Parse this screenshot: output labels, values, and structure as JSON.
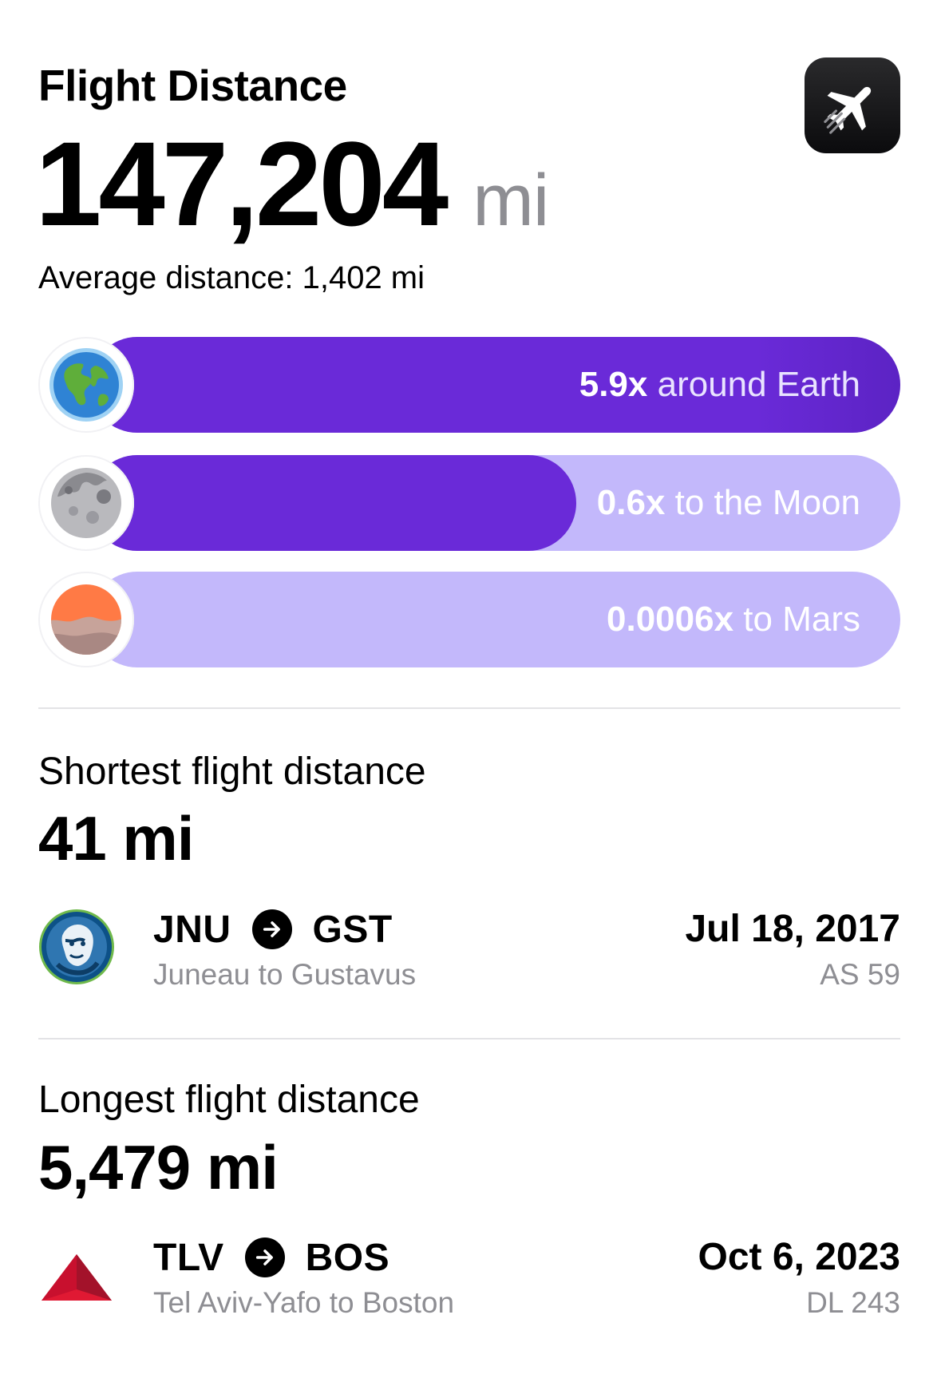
{
  "header": {
    "title": "Flight Distance",
    "app_icon": "airplane-icon"
  },
  "total": {
    "value": "147,204",
    "unit": "mi",
    "average": "Average distance: 1,402 mi"
  },
  "comparisons": [
    {
      "icon": "earth-icon",
      "multiplier": "5.9x",
      "label": "around Earth",
      "fill_fraction": 1.0
    },
    {
      "icon": "moon-icon",
      "multiplier": "0.6x",
      "label": "to the Moon",
      "fill_fraction": 0.6
    },
    {
      "icon": "mars-icon",
      "multiplier": "0.0006x",
      "label": "to Mars",
      "fill_fraction": 0.0006
    }
  ],
  "colors": {
    "bar_fill": "#6a2ad8",
    "bar_track": "#c3b8fb"
  },
  "shortest": {
    "label": "Shortest flight distance",
    "value": "41 mi",
    "flight": {
      "airline_logo": "alaska-airlines-logo",
      "from": "JNU",
      "to": "GST",
      "description": "Juneau to Gustavus",
      "date": "Jul 18, 2017",
      "flight_number": "AS 59"
    }
  },
  "longest": {
    "label": "Longest flight distance",
    "value": "5,479 mi",
    "flight": {
      "airline_logo": "delta-logo",
      "from": "TLV",
      "to": "BOS",
      "description": "Tel Aviv-Yafo to Boston",
      "date": "Oct 6, 2023",
      "flight_number": "DL 243"
    }
  }
}
